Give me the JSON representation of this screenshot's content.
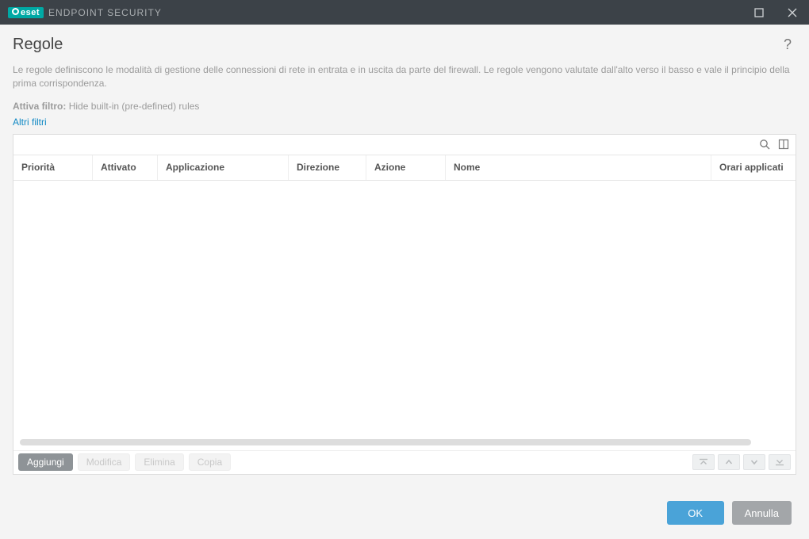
{
  "titlebar": {
    "brand": "eset",
    "product": "ENDPOINT SECURITY"
  },
  "page": {
    "title": "Regole",
    "description": "Le regole definiscono le modalità di gestione delle connessioni di rete in entrata e in uscita da parte del firewall. Le regole vengono valutate dall'alto verso il basso e vale il principio della prima corrispondenza."
  },
  "filter": {
    "label": "Attiva filtro:",
    "value": "Hide built-in (pre-defined) rules",
    "more_link": "Altri filtri"
  },
  "table": {
    "columns": {
      "priority": "Priorità",
      "enabled": "Attivato",
      "application": "Applicazione",
      "direction": "Direzione",
      "action": "Azione",
      "name": "Nome",
      "schedule": "Orari applicati"
    },
    "rows": []
  },
  "actions": {
    "add": "Aggiungi",
    "edit": "Modifica",
    "delete": "Elimina",
    "copy": "Copia"
  },
  "dialog": {
    "ok": "OK",
    "cancel": "Annulla"
  }
}
